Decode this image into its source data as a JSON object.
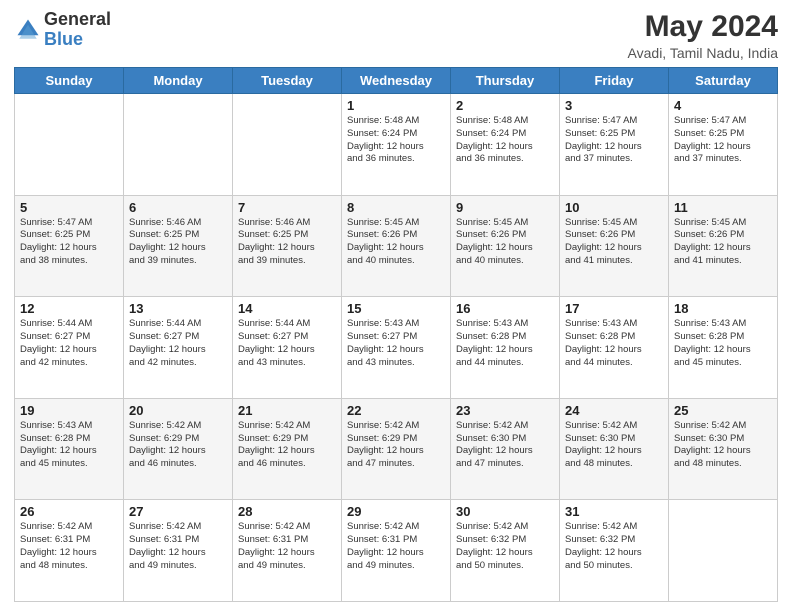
{
  "logo": {
    "general": "General",
    "blue": "Blue"
  },
  "title": "May 2024",
  "subtitle": "Avadi, Tamil Nadu, India",
  "weekdays": [
    "Sunday",
    "Monday",
    "Tuesday",
    "Wednesday",
    "Thursday",
    "Friday",
    "Saturday"
  ],
  "weeks": [
    [
      {
        "day": "",
        "info": ""
      },
      {
        "day": "",
        "info": ""
      },
      {
        "day": "",
        "info": ""
      },
      {
        "day": "1",
        "info": "Sunrise: 5:48 AM\nSunset: 6:24 PM\nDaylight: 12 hours\nand 36 minutes."
      },
      {
        "day": "2",
        "info": "Sunrise: 5:48 AM\nSunset: 6:24 PM\nDaylight: 12 hours\nand 36 minutes."
      },
      {
        "day": "3",
        "info": "Sunrise: 5:47 AM\nSunset: 6:25 PM\nDaylight: 12 hours\nand 37 minutes."
      },
      {
        "day": "4",
        "info": "Sunrise: 5:47 AM\nSunset: 6:25 PM\nDaylight: 12 hours\nand 37 minutes."
      }
    ],
    [
      {
        "day": "5",
        "info": "Sunrise: 5:47 AM\nSunset: 6:25 PM\nDaylight: 12 hours\nand 38 minutes."
      },
      {
        "day": "6",
        "info": "Sunrise: 5:46 AM\nSunset: 6:25 PM\nDaylight: 12 hours\nand 39 minutes."
      },
      {
        "day": "7",
        "info": "Sunrise: 5:46 AM\nSunset: 6:25 PM\nDaylight: 12 hours\nand 39 minutes."
      },
      {
        "day": "8",
        "info": "Sunrise: 5:45 AM\nSunset: 6:26 PM\nDaylight: 12 hours\nand 40 minutes."
      },
      {
        "day": "9",
        "info": "Sunrise: 5:45 AM\nSunset: 6:26 PM\nDaylight: 12 hours\nand 40 minutes."
      },
      {
        "day": "10",
        "info": "Sunrise: 5:45 AM\nSunset: 6:26 PM\nDaylight: 12 hours\nand 41 minutes."
      },
      {
        "day": "11",
        "info": "Sunrise: 5:45 AM\nSunset: 6:26 PM\nDaylight: 12 hours\nand 41 minutes."
      }
    ],
    [
      {
        "day": "12",
        "info": "Sunrise: 5:44 AM\nSunset: 6:27 PM\nDaylight: 12 hours\nand 42 minutes."
      },
      {
        "day": "13",
        "info": "Sunrise: 5:44 AM\nSunset: 6:27 PM\nDaylight: 12 hours\nand 42 minutes."
      },
      {
        "day": "14",
        "info": "Sunrise: 5:44 AM\nSunset: 6:27 PM\nDaylight: 12 hours\nand 43 minutes."
      },
      {
        "day": "15",
        "info": "Sunrise: 5:43 AM\nSunset: 6:27 PM\nDaylight: 12 hours\nand 43 minutes."
      },
      {
        "day": "16",
        "info": "Sunrise: 5:43 AM\nSunset: 6:28 PM\nDaylight: 12 hours\nand 44 minutes."
      },
      {
        "day": "17",
        "info": "Sunrise: 5:43 AM\nSunset: 6:28 PM\nDaylight: 12 hours\nand 44 minutes."
      },
      {
        "day": "18",
        "info": "Sunrise: 5:43 AM\nSunset: 6:28 PM\nDaylight: 12 hours\nand 45 minutes."
      }
    ],
    [
      {
        "day": "19",
        "info": "Sunrise: 5:43 AM\nSunset: 6:28 PM\nDaylight: 12 hours\nand 45 minutes."
      },
      {
        "day": "20",
        "info": "Sunrise: 5:42 AM\nSunset: 6:29 PM\nDaylight: 12 hours\nand 46 minutes."
      },
      {
        "day": "21",
        "info": "Sunrise: 5:42 AM\nSunset: 6:29 PM\nDaylight: 12 hours\nand 46 minutes."
      },
      {
        "day": "22",
        "info": "Sunrise: 5:42 AM\nSunset: 6:29 PM\nDaylight: 12 hours\nand 47 minutes."
      },
      {
        "day": "23",
        "info": "Sunrise: 5:42 AM\nSunset: 6:30 PM\nDaylight: 12 hours\nand 47 minutes."
      },
      {
        "day": "24",
        "info": "Sunrise: 5:42 AM\nSunset: 6:30 PM\nDaylight: 12 hours\nand 48 minutes."
      },
      {
        "day": "25",
        "info": "Sunrise: 5:42 AM\nSunset: 6:30 PM\nDaylight: 12 hours\nand 48 minutes."
      }
    ],
    [
      {
        "day": "26",
        "info": "Sunrise: 5:42 AM\nSunset: 6:31 PM\nDaylight: 12 hours\nand 48 minutes."
      },
      {
        "day": "27",
        "info": "Sunrise: 5:42 AM\nSunset: 6:31 PM\nDaylight: 12 hours\nand 49 minutes."
      },
      {
        "day": "28",
        "info": "Sunrise: 5:42 AM\nSunset: 6:31 PM\nDaylight: 12 hours\nand 49 minutes."
      },
      {
        "day": "29",
        "info": "Sunrise: 5:42 AM\nSunset: 6:31 PM\nDaylight: 12 hours\nand 49 minutes."
      },
      {
        "day": "30",
        "info": "Sunrise: 5:42 AM\nSunset: 6:32 PM\nDaylight: 12 hours\nand 50 minutes."
      },
      {
        "day": "31",
        "info": "Sunrise: 5:42 AM\nSunset: 6:32 PM\nDaylight: 12 hours\nand 50 minutes."
      },
      {
        "day": "",
        "info": ""
      }
    ]
  ]
}
